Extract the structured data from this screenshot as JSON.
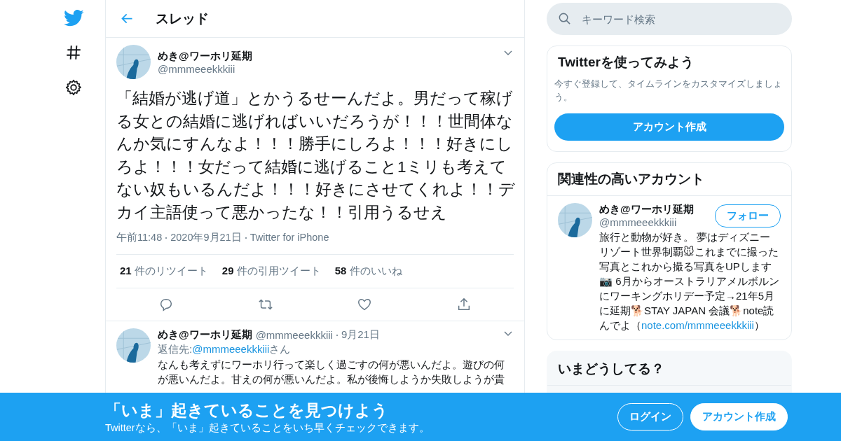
{
  "header": {
    "title": "スレッド"
  },
  "tweet": {
    "name": "めき@ワーホリ延期",
    "handle": "@mmmeeekkkiii",
    "text": "「結婚が逃げ道」とかうるせーんだよ。男だって稼げる女との結婚に逃げればいいだろうが！！！世間体なんか気にすんなよ！！！勝手にしろよ！！！好きにしろよ！！！女だって結婚に逃げること1ミリも考えてない奴もいるんだよ！！！好きにさせてくれよ！！デカイ主語使って悪かったな！！引用うるせえ",
    "time": "午前11:48",
    "date": "2020年9月21日",
    "source": "Twitter for iPhone",
    "stats": [
      {
        "count": "21",
        "label": "件のリツイート"
      },
      {
        "count": "29",
        "label": "件の引用ツイート"
      },
      {
        "count": "58",
        "label": "件のいいね"
      }
    ],
    "actions": [
      {
        "kind": "reply"
      },
      {
        "kind": "retweet"
      },
      {
        "kind": "like"
      },
      {
        "kind": "share"
      }
    ]
  },
  "reply": {
    "name": "めき@ワーホリ延期",
    "handle": "@mmmeeekkkiii",
    "date": "9月21日",
    "reply_to_label": "返信先:",
    "reply_to": "@mmmeeekkkiii",
    "reply_to_suffix": "さん",
    "text": "なんも考えずにワーホリ行って楽しく過ごすの何が悪いんだよ。遊びの何が悪いんだよ。甘えの何が悪いんだよ。私が後悔しようか失敗しようが貴"
  },
  "search": {
    "placeholder": "キーワード検索"
  },
  "signup_card": {
    "title": "Twitterを使ってみよう",
    "text": "今すぐ登録して、タイムラインをカスタマイズしましょう。",
    "button": "アカウント作成"
  },
  "related": {
    "title": "関連性の高いアカウント",
    "name": "めき@ワーホリ延期",
    "handle": "@mmmeeekkkiii",
    "follow": "フォロー",
    "bio": "旅行と動物が好き。 夢はディズニーリゾート世界制覇🐭これまでに撮った写真とこれから撮る写真をUPします📷 6月からオーストラリアメルボルンにワーキングホリデー予定→21年5月に延期🐕STAY JAPAN 会議🐕note読んでよ（",
    "bio_link": "note.com/mmmeeekkkiii",
    "bio_end": "）"
  },
  "trends": {
    "title": "いまどうしてる？"
  },
  "banner": {
    "title": "「いま」起きていることを見つけよう",
    "text": "Twitterなら、「いま」起きていることをいち早くチェックできます。",
    "buttons": [
      {
        "kind": "outline",
        "label": "ログイン"
      },
      {
        "kind": "solid",
        "label": "アカウント作成"
      }
    ]
  }
}
